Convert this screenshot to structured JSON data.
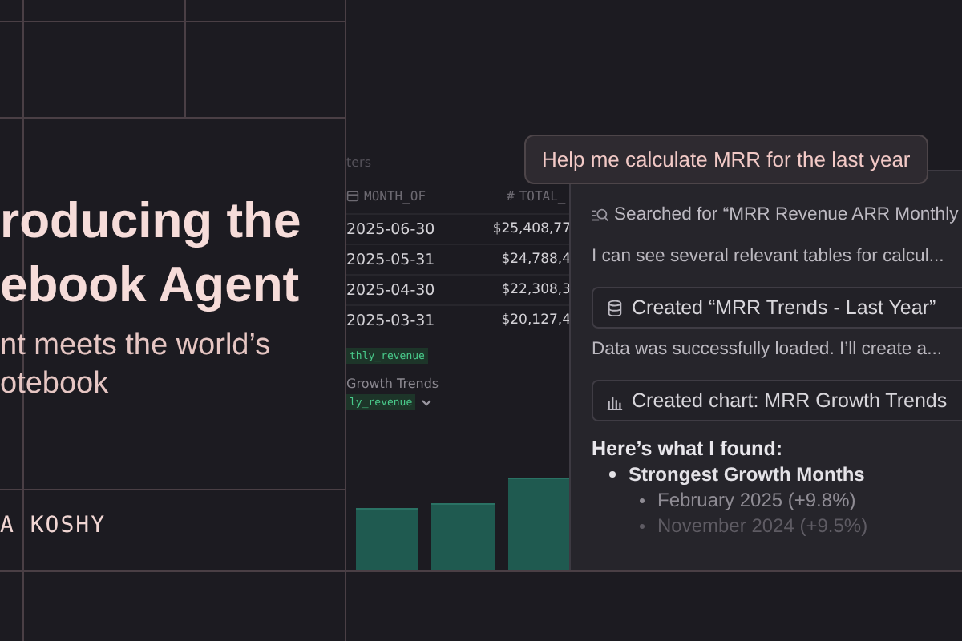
{
  "hero": {
    "title_lines": [
      "roducing the",
      "ebook Agent"
    ],
    "subtitle_lines": [
      "nt meets the world’s",
      "otebook"
    ],
    "author": "A KOSHY"
  },
  "notebook": {
    "filter_label": "ters",
    "columns": [
      {
        "kind": "date",
        "name": "MONTH_OF"
      },
      {
        "kind": "number",
        "symbol": "#",
        "name": "TOTAL_"
      }
    ],
    "rows": [
      [
        "2025-06-30",
        "$25,408,77"
      ],
      [
        "2025-05-31",
        "$24,788,4"
      ],
      [
        "2025-04-30",
        "$22,308,3"
      ],
      [
        "2025-03-31",
        "$20,127,4"
      ]
    ],
    "source_tag": "thly_revenue",
    "chart_title": "Growth Trends",
    "chart_tag": "ly_revenue"
  },
  "chat": {
    "prompt": "Help me calculate MRR for the last year",
    "steps": [
      {
        "kind": "search",
        "text": "Searched for “MRR Revenue ARR Monthly"
      },
      {
        "kind": "message",
        "text": "I can see several relevant tables for calcul..."
      },
      {
        "kind": "table-card",
        "text": "Created “MRR Trends - Last Year”"
      },
      {
        "kind": "message",
        "text": "Data was successfully loaded. I’ll create a..."
      },
      {
        "kind": "chart-card",
        "text": "Created chart: MRR Growth Trends"
      }
    ],
    "summary": {
      "heading": "Here’s what I found:",
      "items": [
        {
          "text": "Strongest Growth Months",
          "children": [
            {
              "text": "February 2025 (+9.8%)"
            },
            {
              "text": "November 2024  (+9.5%)"
            }
          ]
        }
      ]
    }
  }
}
